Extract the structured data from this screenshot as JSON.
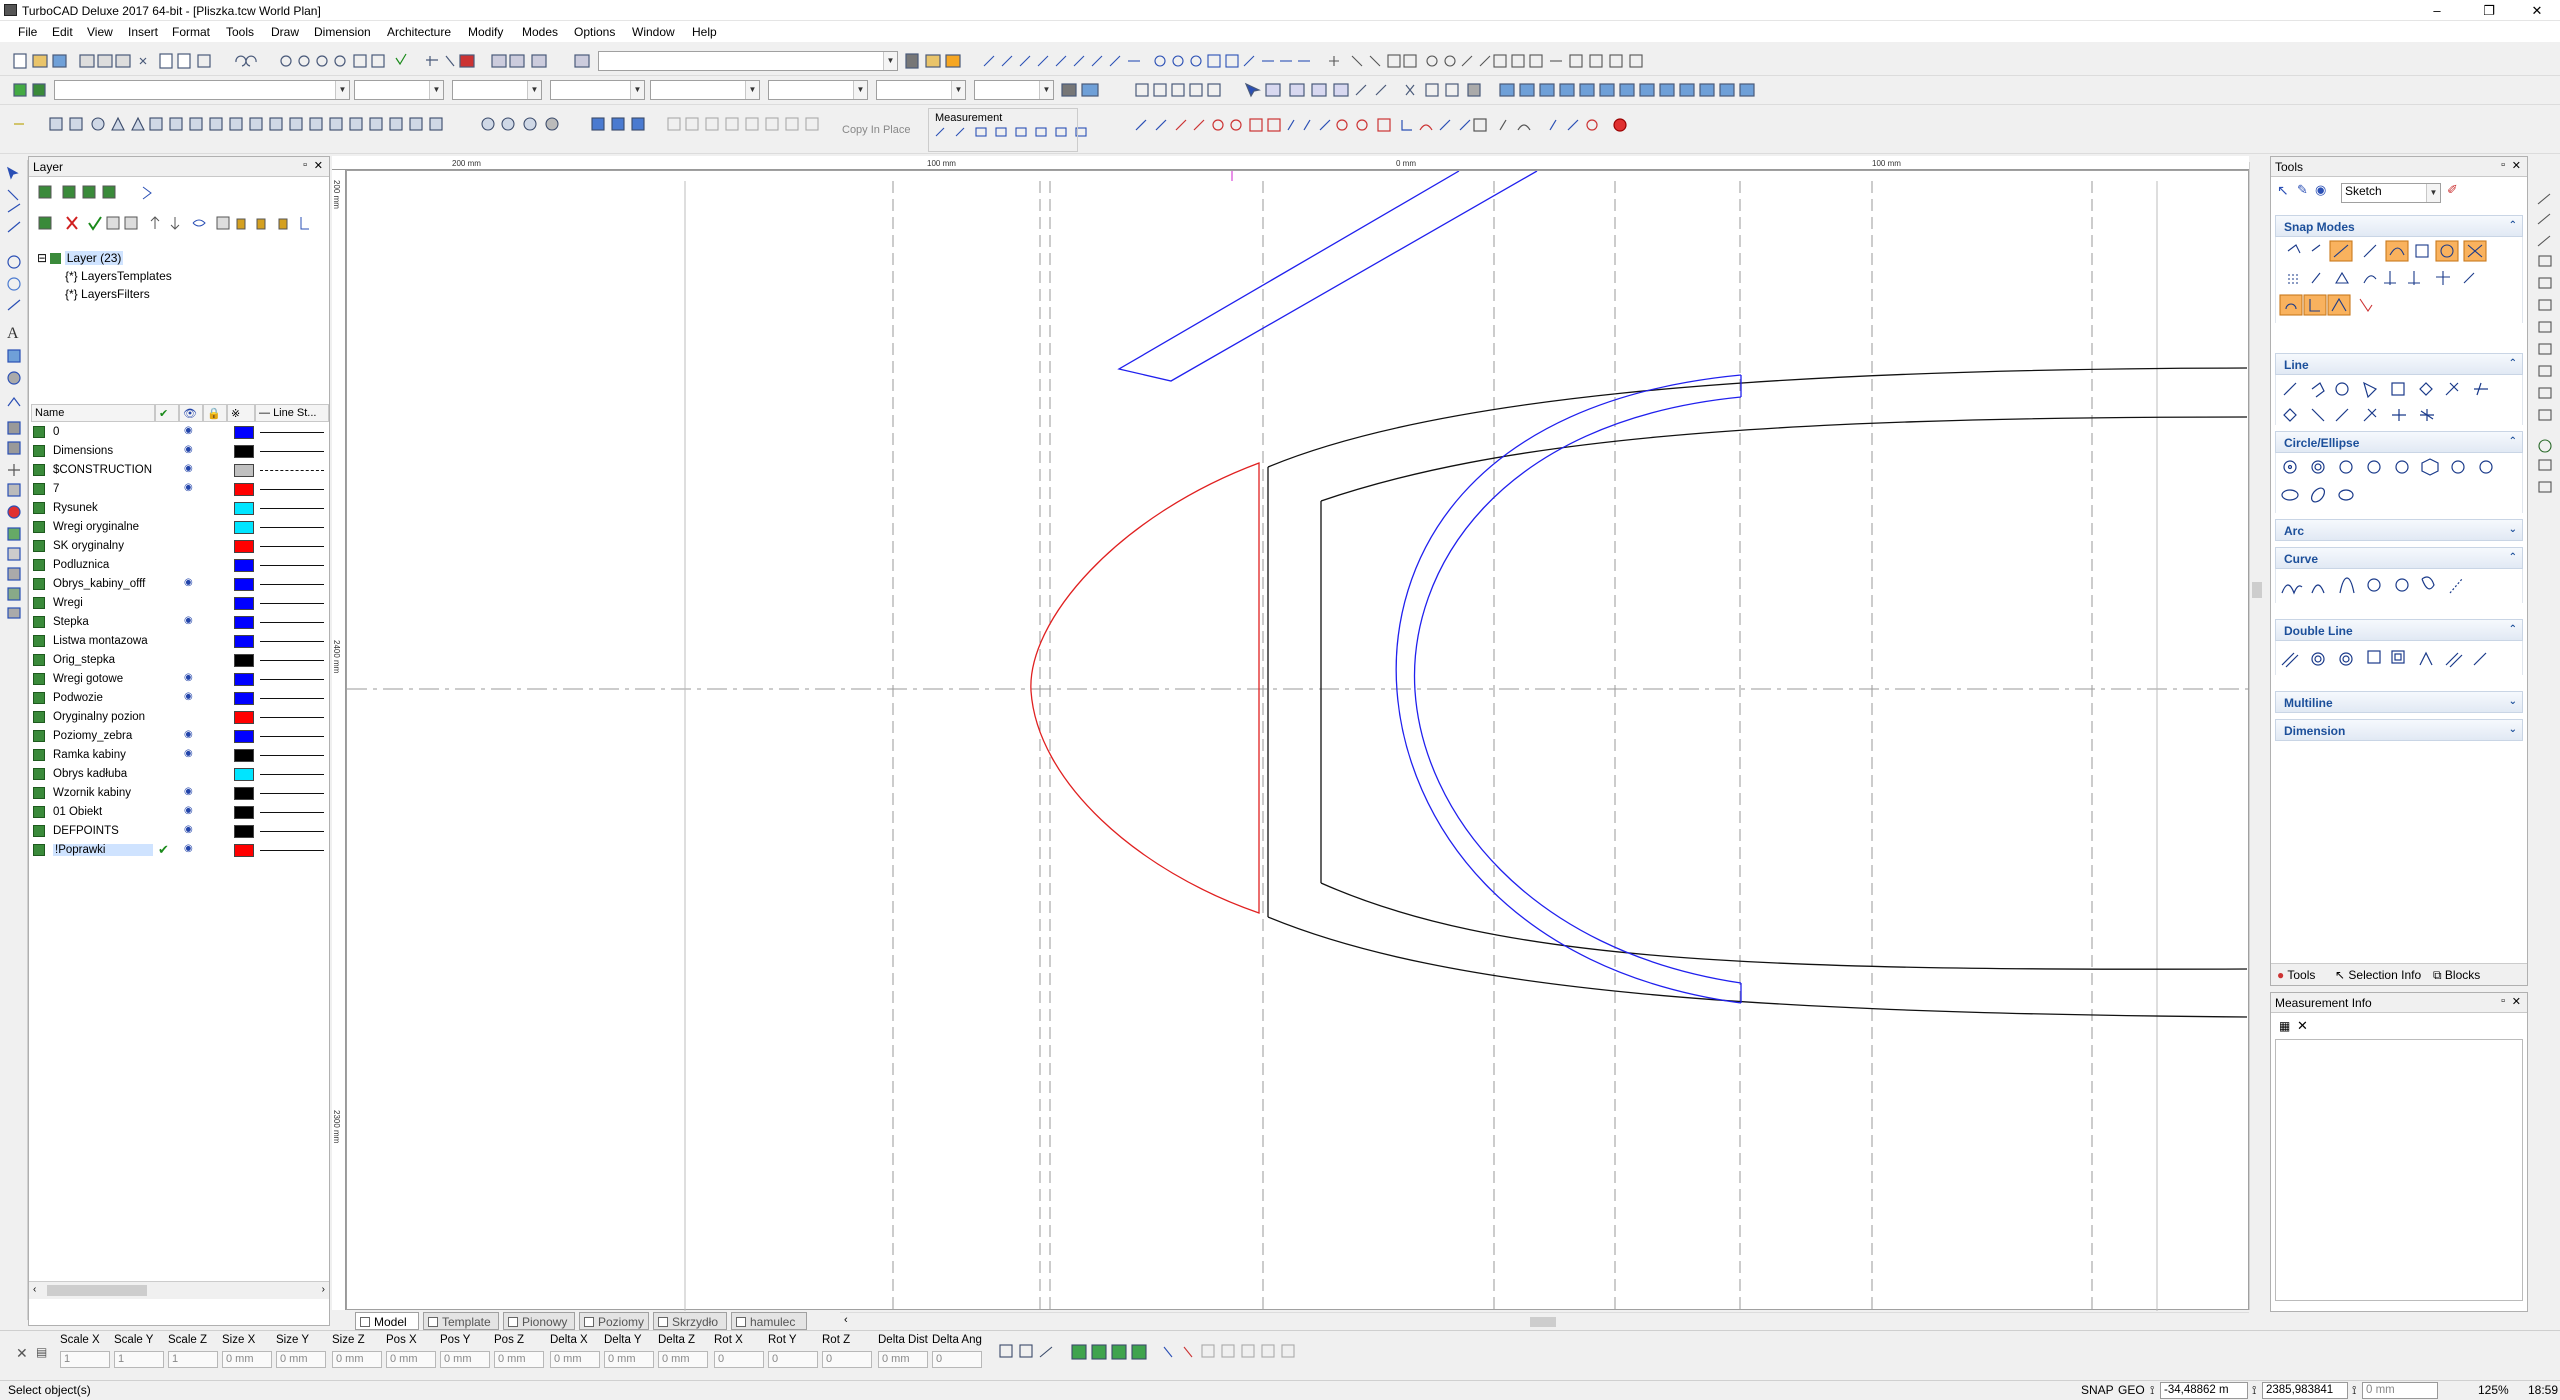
{
  "window": {
    "title": "TurboCAD Deluxe 2017 64-bit - [Pliszka.tcw World Plan]",
    "controls": {
      "minimize": "–",
      "restore": "❐",
      "close": "✕"
    }
  },
  "menu": [
    "File",
    "Edit",
    "View",
    "Insert",
    "Format",
    "Tools",
    "Draw",
    "Dimension",
    "Architecture",
    "Modify",
    "Modes",
    "Options",
    "Window",
    "Help"
  ],
  "toolbar": {
    "copy_in_place": "Copy In Place",
    "measurement": "Measurement"
  },
  "layer_panel": {
    "title": "Layer",
    "tree": {
      "root": "Layer (23)",
      "child1": "LayersTemplates",
      "child2": "LayersFilters"
    },
    "columns": {
      "name": "Name",
      "line_style": "Line St..."
    },
    "rows": [
      {
        "name": "0",
        "color": "#0000ff",
        "visible": true,
        "current": false,
        "dashed": false
      },
      {
        "name": "Dimensions",
        "color": "#000000",
        "visible": true,
        "current": false,
        "dashed": false
      },
      {
        "name": "$CONSTRUCTION",
        "color": "#c0c0c0",
        "visible": true,
        "current": false,
        "dashed": true
      },
      {
        "name": "7",
        "color": "#ff0000",
        "visible": true,
        "current": false,
        "dashed": false
      },
      {
        "name": "Rysunek",
        "color": "#00e5ff",
        "visible": false,
        "current": false,
        "dashed": false
      },
      {
        "name": "Wregi oryginalne",
        "color": "#00e5ff",
        "visible": false,
        "current": false,
        "dashed": false
      },
      {
        "name": "SK oryginalny",
        "color": "#ff0000",
        "visible": false,
        "current": false,
        "dashed": false
      },
      {
        "name": "Podluznica",
        "color": "#0000ff",
        "visible": false,
        "current": false,
        "dashed": false
      },
      {
        "name": "Obrys_kabiny_offf",
        "color": "#0000ff",
        "visible": true,
        "current": false,
        "dashed": false
      },
      {
        "name": "Wregi",
        "color": "#0000ff",
        "visible": false,
        "current": false,
        "dashed": false
      },
      {
        "name": "Stepka",
        "color": "#0000ff",
        "visible": true,
        "current": false,
        "dashed": false
      },
      {
        "name": "Listwa montazowa",
        "color": "#0000ff",
        "visible": false,
        "current": false,
        "dashed": false
      },
      {
        "name": "Orig_stepka",
        "color": "#000000",
        "visible": false,
        "current": false,
        "dashed": false
      },
      {
        "name": "Wregi gotowe",
        "color": "#0000ff",
        "visible": true,
        "current": false,
        "dashed": false
      },
      {
        "name": "Podwozie",
        "color": "#0000ff",
        "visible": true,
        "current": false,
        "dashed": false
      },
      {
        "name": "Oryginalny pozion",
        "color": "#ff0000",
        "visible": false,
        "current": false,
        "dashed": false
      },
      {
        "name": "Poziomy_zebra",
        "color": "#0000ff",
        "visible": true,
        "current": false,
        "dashed": false
      },
      {
        "name": "Ramka kabiny",
        "color": "#000000",
        "visible": true,
        "current": false,
        "dashed": false
      },
      {
        "name": "Obrys kadłuba",
        "color": "#00e5ff",
        "visible": false,
        "current": false,
        "dashed": false
      },
      {
        "name": "Wzornik kabiny",
        "color": "#000000",
        "visible": true,
        "current": false,
        "dashed": false
      },
      {
        "name": "01 Obiekt",
        "color": "#000000",
        "visible": true,
        "current": false,
        "dashed": false
      },
      {
        "name": "DEFPOINTS",
        "color": "#000000",
        "visible": true,
        "current": false,
        "dashed": false
      },
      {
        "name": "!Poprawki",
        "color": "#ff0000",
        "visible": true,
        "current": true,
        "dashed": false
      }
    ]
  },
  "ruler": {
    "top": [
      "200 mm",
      "100 mm",
      "0 mm",
      "100 mm"
    ],
    "left": [
      "200 mm",
      "2400 mm",
      "2300 mm"
    ]
  },
  "tabs": [
    "Model",
    "Template",
    "Pionowy",
    "Poziomy",
    "Skrzydło",
    "hamulec"
  ],
  "tools_panel": {
    "title": "Tools",
    "mode": "Sketch",
    "sections": {
      "snap_modes": "Snap Modes",
      "line": "Line",
      "circle_ellipse": "Circle/Ellipse",
      "arc": "Arc",
      "curve": "Curve",
      "double_line": "Double Line",
      "multiline": "Multiline",
      "dimension": "Dimension"
    },
    "bottom_tabs": [
      "Tools",
      "Selection Info",
      "Blocks"
    ]
  },
  "measurement_info": {
    "title": "Measurement Info"
  },
  "inspector": {
    "labels": [
      "Scale X",
      "Scale Y",
      "Scale Z",
      "Size X",
      "Size Y",
      "Size Z",
      "Pos X",
      "Pos Y",
      "Pos Z",
      "Delta X",
      "Delta Y",
      "Delta Z",
      "Rot X",
      "Rot Y",
      "Rot Z",
      "Delta Dist",
      "Delta Ang"
    ],
    "values": [
      "1",
      "1",
      "1",
      "0 mm",
      "0 mm",
      "0 mm",
      "0 mm",
      "0 mm",
      "0 mm",
      "0 mm",
      "0 mm",
      "0 mm",
      "0",
      "0",
      "0",
      "0 mm",
      "0"
    ]
  },
  "status": {
    "message": "Select object(s)",
    "snap": "SNAP",
    "geo": "GEO",
    "coord_x": "-34,48862 m",
    "coord_y": "2385,983841",
    "coord_z": "0 mm",
    "zoom": "125%",
    "time": "18:59"
  },
  "colors": {
    "accent": "#1c4f9a",
    "snap_active": "#f9b25e",
    "drawing_blue": "#2020ee",
    "drawing_red": "#e02020",
    "drawing_black": "#111111"
  }
}
